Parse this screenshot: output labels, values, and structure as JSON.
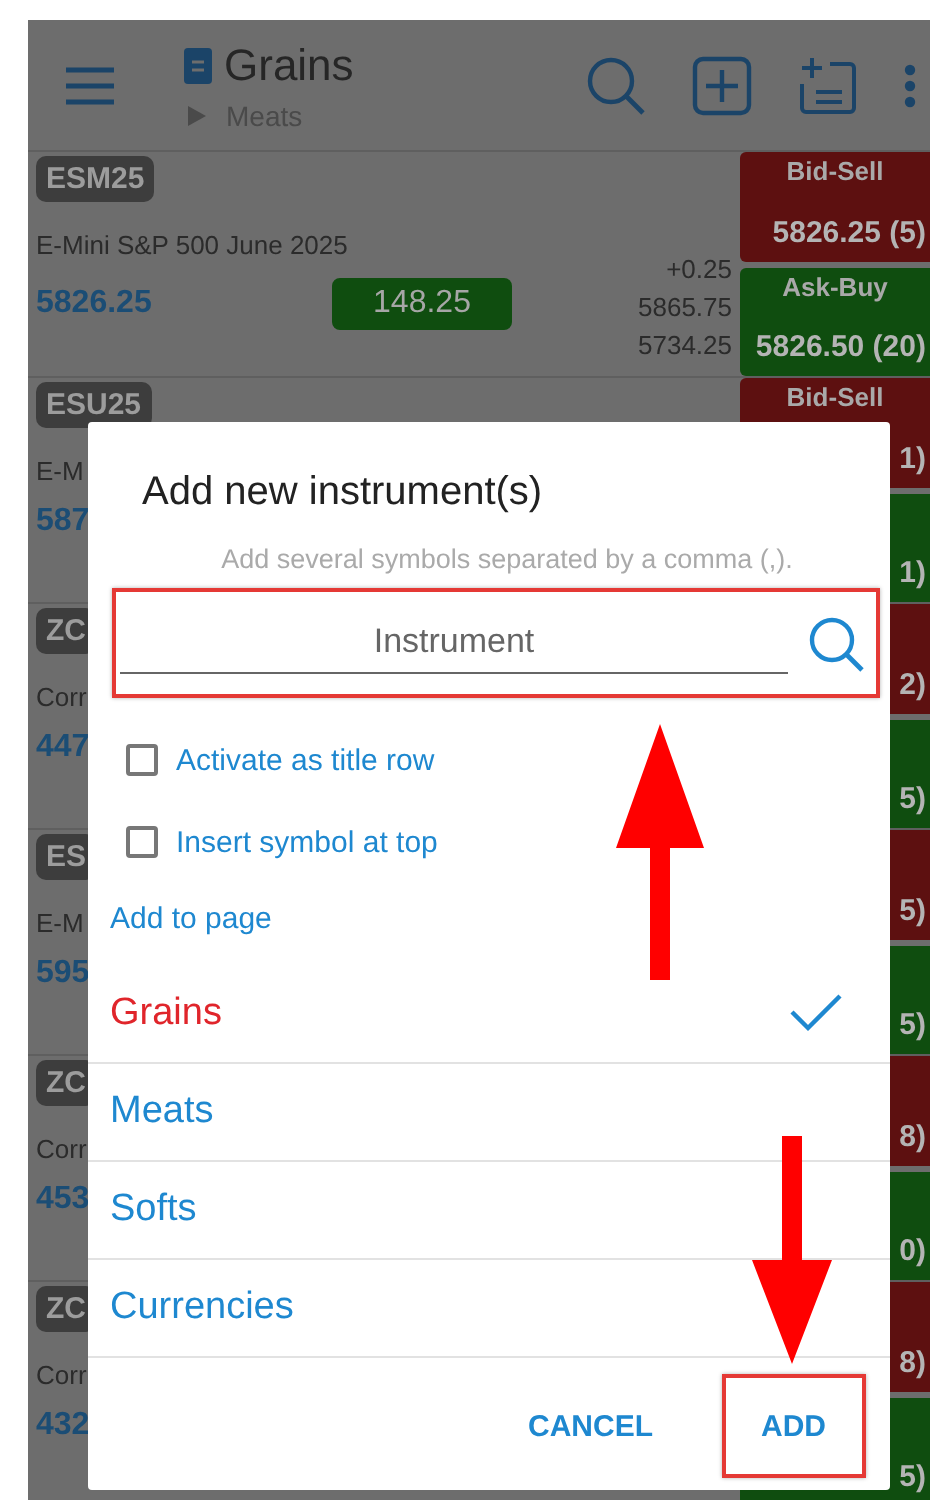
{
  "top_bar": {
    "title": "Grains",
    "subtitle": "Meats"
  },
  "rows": [
    {
      "symbol": "ESM25",
      "name": "E-Mini S&P 500  June 2025",
      "last": "5826.25",
      "change": "148.25",
      "net": "+0.25",
      "high": "5865.75",
      "low": "5734.25",
      "bid_label": "Bid-Sell",
      "bid": "5826.25 (5)",
      "ask_label": "Ask-Buy",
      "ask": "5826.50 (20)"
    },
    {
      "symbol": "ESU25",
      "name": "E-M",
      "last": "587",
      "bid_label": "Bid-Sell",
      "bid": "1)",
      "ask": "1)"
    },
    {
      "symbol": "ZC",
      "name": "Corr",
      "last": "447",
      "bid": "2)",
      "ask": "5)"
    },
    {
      "symbol": "ES",
      "name": "E-M",
      "last": "595",
      "bid": "5)",
      "ask": "5)"
    },
    {
      "symbol": "ZC",
      "name": "Corr",
      "last": "453",
      "bid": "8)",
      "ask": "0)"
    },
    {
      "symbol": "ZC",
      "name": "Corr",
      "last": "432",
      "bid": "8)",
      "ask": "5)"
    }
  ],
  "dialog": {
    "title": "Add new instrument(s)",
    "hint": "Add several symbols separated by a comma (,).",
    "field": {
      "placeholder": "Instrument",
      "highlighted": true
    },
    "options": [
      {
        "label": "Activate as title row",
        "checked": false
      },
      {
        "label": "Insert symbol at top",
        "checked": false
      }
    ],
    "section_label": "Add to page",
    "pages": [
      {
        "label": "Grains",
        "selected": true
      },
      {
        "label": "Meats",
        "selected": false
      },
      {
        "label": "Softs",
        "selected": false
      },
      {
        "label": "Currencies",
        "selected": false
      }
    ],
    "buttons": [
      {
        "label": "CANCEL",
        "highlighted": false
      },
      {
        "label": "ADD",
        "highlighted": true
      }
    ]
  }
}
